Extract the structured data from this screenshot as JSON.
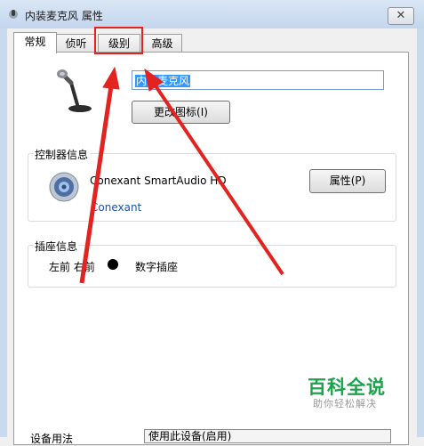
{
  "window": {
    "title": "内装麦克风 属性",
    "close_glyph": "✕"
  },
  "tabs": [
    {
      "label": "常规",
      "active": true
    },
    {
      "label": "侦听",
      "active": false
    },
    {
      "label": "级别",
      "active": false
    },
    {
      "label": "高级",
      "active": false
    }
  ],
  "general": {
    "device_name_value": "内装麦克风",
    "change_icon_label": "更改图标(I)"
  },
  "controller": {
    "group_label": "控制器信息",
    "device_name": "Conexant SmartAudio HD",
    "vendor_link": "Conexant",
    "properties_button": "属性(P)"
  },
  "jack": {
    "group_label": "插座信息",
    "position": "左前 右前",
    "type": "数字插座"
  },
  "bottom": {
    "label": "设备用法",
    "value": "使用此设备(启用)"
  },
  "watermark": {
    "main": "百科全说",
    "sub": "助你轻松解决"
  },
  "annotation": {
    "color": "#e3231f",
    "highlighted_tab": "级别"
  },
  "icons": [
    "microphone-icon",
    "speaker-icon",
    "close-icon",
    "app-icon"
  ]
}
